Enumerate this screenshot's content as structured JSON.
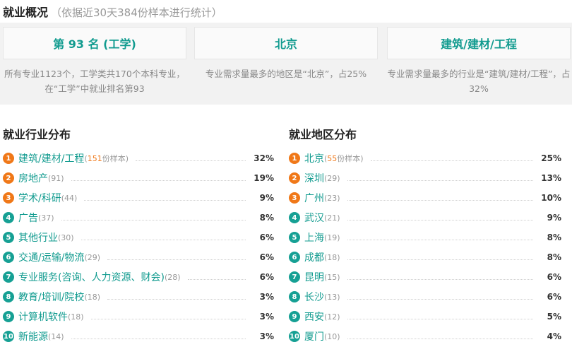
{
  "header": {
    "title": "就业概况",
    "subtitle": "（依据近30天384份样本进行统计）"
  },
  "summary": {
    "cards": [
      {
        "label": "第 93 名 (工学)",
        "desc": "所有专业1123个，工学类共170个本科专业，在“工学”中就业排名第93"
      },
      {
        "label": "北京",
        "desc": "专业需求量最多的地区是“北京”，占25%"
      },
      {
        "label": "建筑/建材/工程",
        "desc": "专业需求量最多的行业是“建筑/建材/工程”，占32%"
      }
    ]
  },
  "industry": {
    "title": "就业行业分布",
    "items": [
      {
        "rank": "1",
        "name": "建筑/建材/工程",
        "count": "(151份样本)",
        "pct": "32%"
      },
      {
        "rank": "2",
        "name": "房地产",
        "count": "(91)",
        "pct": "19%"
      },
      {
        "rank": "3",
        "name": "学术/科研",
        "count": "(44)",
        "pct": "9%"
      },
      {
        "rank": "4",
        "name": "广告",
        "count": "(37)",
        "pct": "8%"
      },
      {
        "rank": "5",
        "name": "其他行业",
        "count": "(30)",
        "pct": "6%"
      },
      {
        "rank": "6",
        "name": "交通/运输/物流",
        "count": "(29)",
        "pct": "6%"
      },
      {
        "rank": "7",
        "name": "专业服务(咨询、人力资源、财会)",
        "count": "(28)",
        "pct": "6%"
      },
      {
        "rank": "8",
        "name": "教育/培训/院校",
        "count": "(18)",
        "pct": "3%"
      },
      {
        "rank": "9",
        "name": "计算机软件",
        "count": "(18)",
        "pct": "3%"
      },
      {
        "rank": "10",
        "name": "新能源",
        "count": "(14)",
        "pct": "3%"
      }
    ]
  },
  "region": {
    "title": "就业地区分布",
    "items": [
      {
        "rank": "1",
        "name": "北京",
        "count": "(55份样本)",
        "pct": "25%"
      },
      {
        "rank": "2",
        "name": "深圳",
        "count": "(29)",
        "pct": "13%"
      },
      {
        "rank": "3",
        "name": "广州",
        "count": "(23)",
        "pct": "10%"
      },
      {
        "rank": "4",
        "name": "武汉",
        "count": "(21)",
        "pct": "9%"
      },
      {
        "rank": "5",
        "name": "上海",
        "count": "(19)",
        "pct": "8%"
      },
      {
        "rank": "6",
        "name": "成都",
        "count": "(18)",
        "pct": "8%"
      },
      {
        "rank": "7",
        "name": "昆明",
        "count": "(15)",
        "pct": "6%"
      },
      {
        "rank": "8",
        "name": "长沙",
        "count": "(13)",
        "pct": "6%"
      },
      {
        "rank": "9",
        "name": "西安",
        "count": "(12)",
        "pct": "5%"
      },
      {
        "rank": "10",
        "name": "厦门",
        "count": "(10)",
        "pct": "4%"
      }
    ]
  },
  "colors": {
    "accent": "#119b8f",
    "hot_rank": "#f07818",
    "rank": "#16a094",
    "summary_bg": "#f2f2f2"
  }
}
